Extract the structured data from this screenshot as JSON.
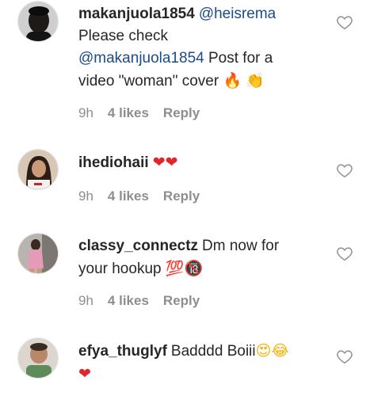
{
  "comments": [
    {
      "username": "makanjuola1854",
      "mention": "@heisrema",
      "lines": [
        "Please check",
        "@makanjuola1854",
        " Post for a",
        "video \"woman\" cover "
      ],
      "emojis": [
        "🔥",
        "👏"
      ],
      "time": "9h",
      "likes": "4 likes",
      "reply": "Reply",
      "avatar_icon": "avatar-man-dark"
    },
    {
      "username": "ihediohaii",
      "text": "",
      "emojis": [
        "❤",
        "❤"
      ],
      "time": "9h",
      "likes": "4 likes",
      "reply": "Reply",
      "avatar_icon": "avatar-woman-long-hair"
    },
    {
      "username": "classy_connectz",
      "text": "Dm now for",
      "text2": "your hookup ",
      "emojis": [
        "💯",
        "🔞"
      ],
      "time": "9h",
      "likes": "4 likes",
      "reply": "Reply",
      "avatar_icon": "avatar-woman-pink-dress"
    },
    {
      "username": "efya_thuglyf",
      "text": "Badddd Boiii",
      "emojis": [
        "😍",
        "😂",
        "❤"
      ],
      "avatar_icon": "avatar-child"
    }
  ],
  "icons": {
    "like": "heart-outline-icon"
  },
  "colors": {
    "mention": "#1a4b8a",
    "meta": "#8e8e8e",
    "heart_red": "#e0262b"
  }
}
